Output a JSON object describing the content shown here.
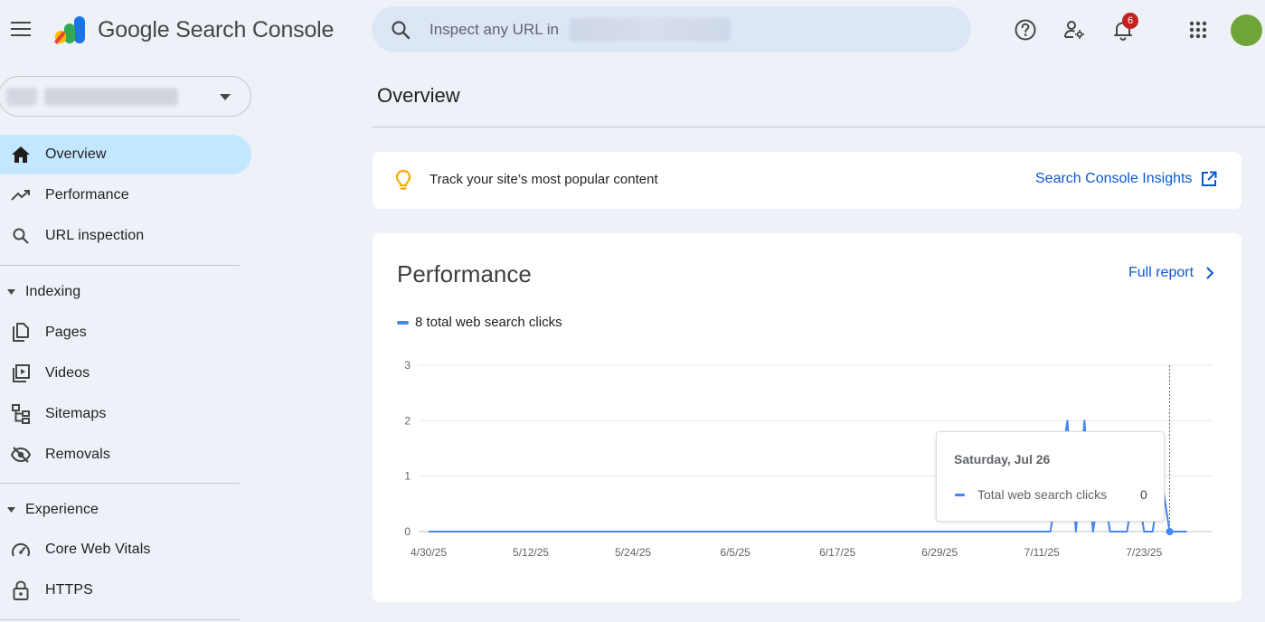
{
  "app": {
    "title": "Google Search Console",
    "colors": {
      "accent": "#0b57d0",
      "active_nav": "#c2e7ff",
      "series": "#4285f4",
      "avatar": "#6fa43a",
      "badge": "#c5221f"
    }
  },
  "header": {
    "search_placeholder": "Inspect any URL in",
    "notifications_count": "6",
    "icons": [
      "menu-icon",
      "search-icon",
      "help-icon",
      "manage-users-icon",
      "notifications-icon",
      "apps-grid-icon"
    ]
  },
  "sidebar": {
    "items": [
      {
        "label": "Overview",
        "icon": "home-icon",
        "active": true
      },
      {
        "label": "Performance",
        "icon": "trending-up-icon"
      },
      {
        "label": "URL inspection",
        "icon": "search-icon"
      }
    ],
    "sections": [
      {
        "label": "Indexing",
        "items": [
          {
            "label": "Pages",
            "icon": "pages-icon"
          },
          {
            "label": "Videos",
            "icon": "video-icon"
          },
          {
            "label": "Sitemaps",
            "icon": "sitemap-icon"
          },
          {
            "label": "Removals",
            "icon": "eye-off-icon"
          }
        ]
      },
      {
        "label": "Experience",
        "items": [
          {
            "label": "Core Web Vitals",
            "icon": "gauge-icon"
          },
          {
            "label": "HTTPS",
            "icon": "lock-icon"
          }
        ]
      }
    ]
  },
  "main": {
    "page_title": "Overview",
    "insights": {
      "text": "Track your site’s most popular content",
      "link_label": "Search Console Insights"
    },
    "performance": {
      "title": "Performance",
      "full_report_label": "Full report",
      "legend_label": "8 total web search clicks",
      "tooltip": {
        "date": "Saturday, Jul 26",
        "series_label": "Total web search clicks",
        "value": "0"
      }
    }
  },
  "chart_data": {
    "type": "line",
    "x_tick_labels": [
      "4/30/25",
      "5/12/25",
      "5/24/25",
      "6/5/25",
      "6/17/25",
      "6/29/25",
      "7/11/25",
      "7/23/25"
    ],
    "y_tick_labels": [
      "0",
      "1",
      "2",
      "3"
    ],
    "ylim": [
      0,
      3
    ],
    "grid": true,
    "series": [
      {
        "name": "Total web search clicks",
        "color": "#4285f4",
        "x": [
          "2025-04-30",
          "2025-07-12",
          "2025-07-13",
          "2025-07-14",
          "2025-07-15",
          "2025-07-16",
          "2025-07-17",
          "2025-07-18",
          "2025-07-19",
          "2025-07-20",
          "2025-07-21",
          "2025-07-22",
          "2025-07-23",
          "2025-07-24",
          "2025-07-25",
          "2025-07-26",
          "2025-07-27",
          "2025-07-28"
        ],
        "values": [
          0,
          0,
          1,
          2,
          0,
          2,
          0,
          1,
          0,
          0,
          0,
          1,
          0,
          0,
          1,
          0,
          0,
          0
        ]
      }
    ],
    "highlight": {
      "x": "2025-07-26",
      "value": 0
    }
  }
}
